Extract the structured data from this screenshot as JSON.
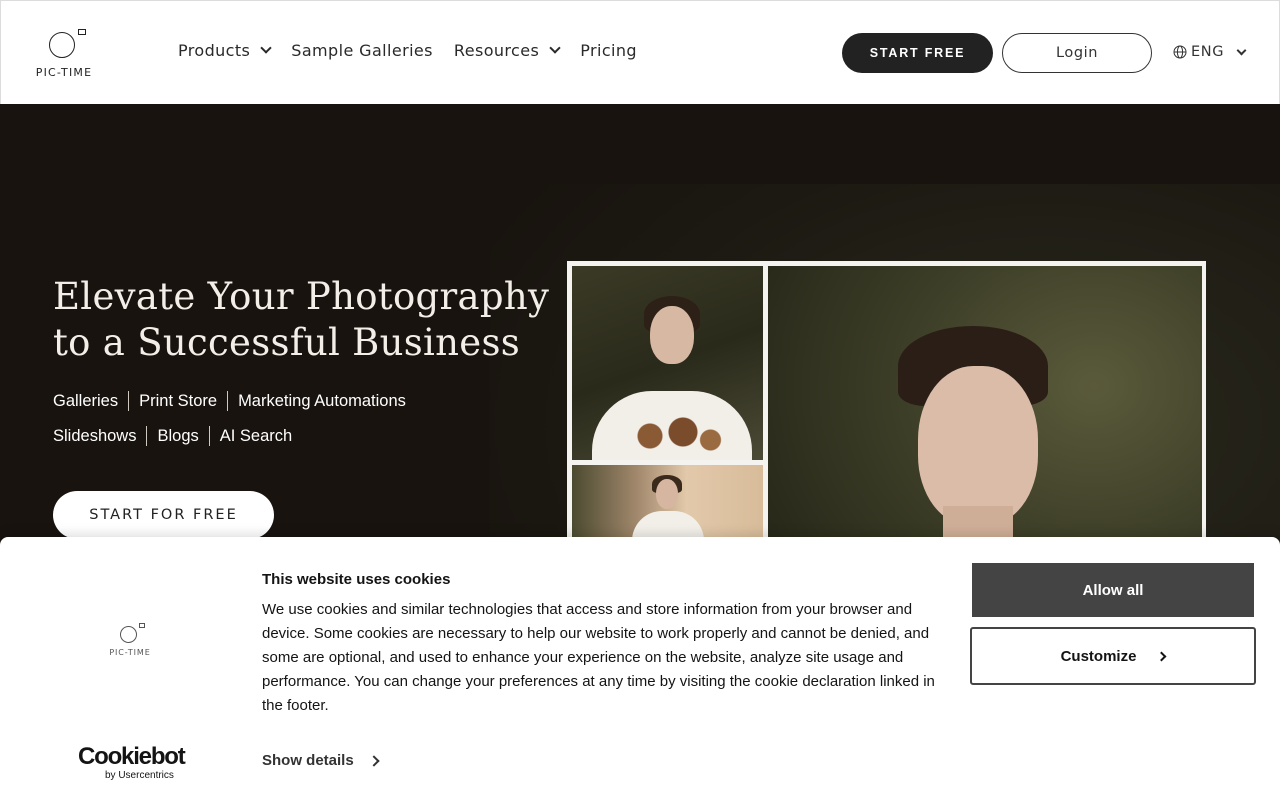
{
  "header": {
    "logo_text": "PIC-TIME",
    "nav": [
      {
        "label": "Products",
        "has_dropdown": true
      },
      {
        "label": "Sample Galleries",
        "has_dropdown": false
      },
      {
        "label": "Resources",
        "has_dropdown": true
      },
      {
        "label": "Pricing",
        "has_dropdown": false
      }
    ],
    "start_free": "START FREE",
    "login": "Login",
    "language": "ENG"
  },
  "hero": {
    "title_line1": "Elevate Your Photography",
    "title_line2": "to a Successful Business",
    "links_row1": [
      "Galleries",
      "Print Store",
      "Marketing Automations"
    ],
    "links_row2": [
      "Slideshows",
      "Blogs",
      "AI Search"
    ],
    "cta": "START FOR FREE"
  },
  "cookie": {
    "logo_text": "PIC-TIME",
    "title": "This website uses cookies",
    "body": "We use cookies and similar technologies that access and store information from your browser and device. Some cookies are necessary to help our website to work properly and cannot be denied, and some are optional, and used to enhance your experience on the website, analyze site usage and performance. You can change your preferences at any time by visiting the cookie declaration linked in the footer.",
    "show_details": "Show details",
    "allow_all": "Allow all",
    "customize": "Customize",
    "brand_name": "Cookiebot",
    "brand_sub": "by Usercentrics"
  },
  "colors": {
    "hero_bg": "#18130e",
    "button_dark": "#222222",
    "allow_button": "#444444"
  }
}
